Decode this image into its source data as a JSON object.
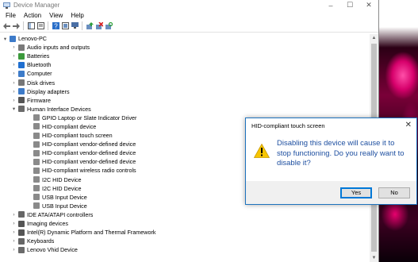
{
  "window": {
    "title": "Device Manager",
    "controls": {
      "minimize": "–",
      "maximize": "☐",
      "close": "✕"
    }
  },
  "menu": [
    "File",
    "Action",
    "View",
    "Help"
  ],
  "tree": {
    "root": "Lenovo-PC",
    "categories": [
      {
        "label": "Audio inputs and outputs",
        "icon": "speaker-icon",
        "expanded": false
      },
      {
        "label": "Batteries",
        "icon": "battery-icon",
        "expanded": false
      },
      {
        "label": "Bluetooth",
        "icon": "bluetooth-icon",
        "expanded": false
      },
      {
        "label": "Computer",
        "icon": "computer-icon",
        "expanded": false
      },
      {
        "label": "Disk drives",
        "icon": "disk-icon",
        "expanded": false
      },
      {
        "label": "Display adapters",
        "icon": "display-icon",
        "expanded": false
      },
      {
        "label": "Firmware",
        "icon": "chip-icon",
        "expanded": false
      },
      {
        "label": "Human Interface Devices",
        "icon": "hid-icon",
        "expanded": true,
        "children": [
          "GPIO Laptop or Slate Indicator Driver",
          "HID-compliant device",
          "HID-compliant touch screen",
          "HID-compliant vendor-defined device",
          "HID-compliant vendor-defined device",
          "HID-compliant vendor-defined device",
          "HID-compliant wireless radio controls",
          "I2C HID Device",
          "I2C HID Device",
          "USB Input Device",
          "USB Input Device"
        ]
      },
      {
        "label": "IDE ATA/ATAPI controllers",
        "icon": "ide-icon",
        "expanded": false
      },
      {
        "label": "Imaging devices",
        "icon": "camera-icon",
        "expanded": false
      },
      {
        "label": "Intel(R) Dynamic Platform and Thermal Framework",
        "icon": "chip-icon",
        "expanded": false
      },
      {
        "label": "Keyboards",
        "icon": "keyboard-icon",
        "expanded": false
      },
      {
        "label": "Lenovo Vhid Device",
        "icon": "device-icon",
        "expanded": false
      }
    ]
  },
  "dialog": {
    "title": "HID-compliant touch screen",
    "message": "Disabling this device will cause it to stop functioning. Do you really want to disable it?",
    "yes_label": "Yes",
    "no_label": "No"
  },
  "colors": {
    "accent": "#0078d7",
    "message": "#1e4fa0"
  }
}
